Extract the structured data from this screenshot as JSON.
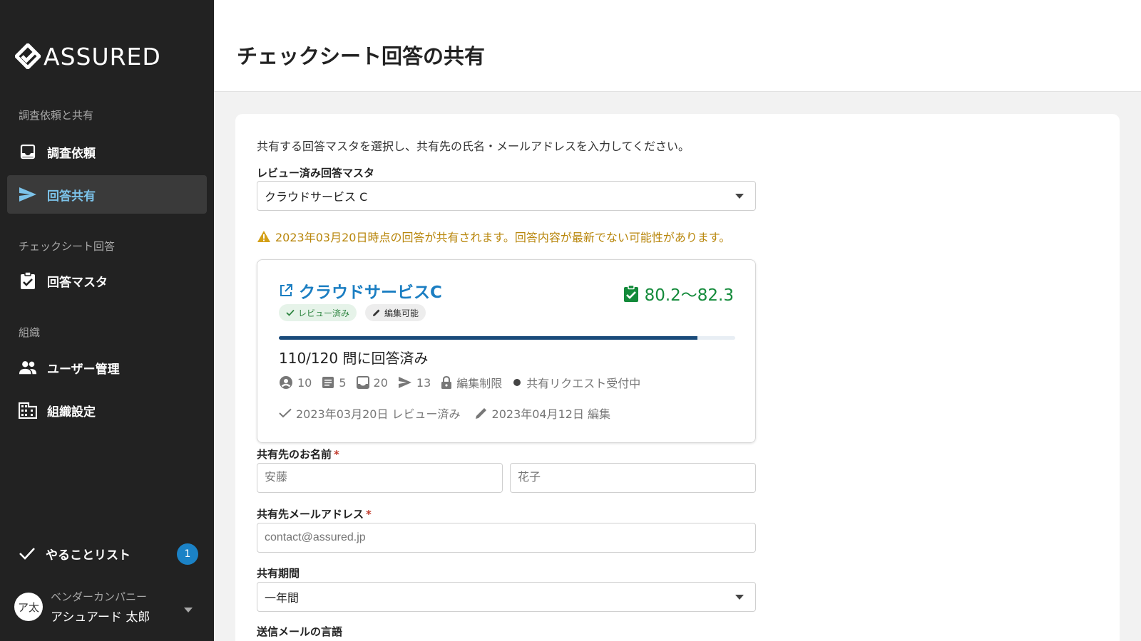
{
  "app": {
    "brand": "ASSURED"
  },
  "sidebar": {
    "sections": [
      {
        "label": "調査依頼と共有"
      },
      {
        "label": "チェックシート回答"
      },
      {
        "label": "組織"
      }
    ],
    "items": [
      {
        "label": "調査依頼",
        "icon": "inbox-icon"
      },
      {
        "label": "回答共有",
        "icon": "send-icon",
        "active": true
      },
      {
        "label": "回答マスタ",
        "icon": "clipboard-check-icon"
      },
      {
        "label": "ユーザー管理",
        "icon": "people-icon"
      },
      {
        "label": "組織設定",
        "icon": "building-icon"
      }
    ],
    "todo": {
      "label": "やることリスト",
      "count": "1"
    },
    "user": {
      "avatar": "ア太",
      "company": "ベンダーカンパニー",
      "name": "アシュアード 太郎"
    }
  },
  "header": {
    "title": "チェックシート回答の共有"
  },
  "form": {
    "instruction": "共有する回答マスタを選択し、共有先の氏名・メールアドレスを入力してください。",
    "master": {
      "label": "レビュー済み回答マスタ",
      "value": "クラウドサービス C"
    },
    "warning": "2023年03月20日時点の回答が共有されます。回答内容が最新でない可能性があります。",
    "service_card": {
      "title": "クラウドサービスC",
      "score": "80.2〜82.3",
      "chips": [
        "レビュー済み",
        "編集可能"
      ],
      "progress": 0.917,
      "answered": "110/120 問に回答済み",
      "stats": [
        "10",
        "5",
        "20",
        "13",
        "編集制限",
        "共有リクエスト受付中"
      ],
      "reviewed": "2023年03月20日 レビュー済み",
      "edited": "2023年04月12日 編集"
    },
    "name": {
      "label": "共有先のお名前",
      "required": "*",
      "last_placeholder": "安藤",
      "first_placeholder": "花子"
    },
    "email": {
      "label": "共有先メールアドレス",
      "required": "*",
      "placeholder": "contact@assured.jp"
    },
    "period": {
      "label": "共有期間",
      "value": "一年間"
    },
    "language": {
      "label": "送信メールの言語"
    }
  },
  "colors": {
    "sidebar_bg": "#222222",
    "accent": "#1b7ec2",
    "active_nav": "#7cc3ea",
    "score": "#138a3a",
    "warning": "#b8860b"
  }
}
